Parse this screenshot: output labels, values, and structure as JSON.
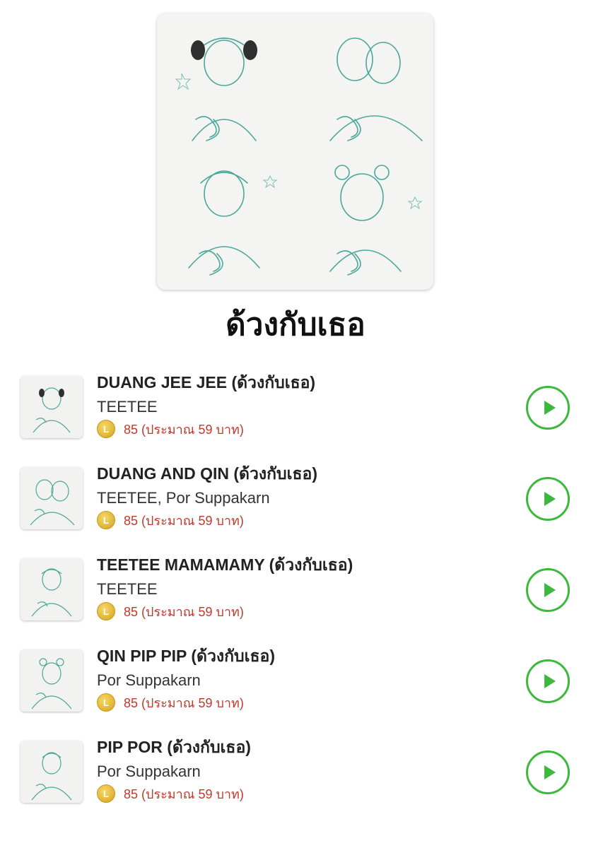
{
  "album": {
    "title": "ด้วงกับเธอ"
  },
  "tracks": [
    {
      "title": "DUANG JEE JEE (ด้วงกับเธอ)",
      "artist": "TEETEE",
      "coin_label": "L",
      "price": "85 (ประมาณ 59 บาท)"
    },
    {
      "title": "DUANG AND QIN (ด้วงกับเธอ)",
      "artist": "TEETEE, Por Suppakarn",
      "coin_label": "L",
      "price": "85 (ประมาณ 59 บาท)"
    },
    {
      "title": "TEETEE MAMAMAMY (ด้วงกับเธอ)",
      "artist": "TEETEE",
      "coin_label": "L",
      "price": "85 (ประมาณ 59 บาท)"
    },
    {
      "title": "QIN PIP PIP (ด้วงกับเธอ)",
      "artist": "Por Suppakarn",
      "coin_label": "L",
      "price": "85 (ประมาณ 59 บาท)"
    },
    {
      "title": "PIP POR (ด้วงกับเธอ)",
      "artist": "Por Suppakarn",
      "coin_label": "L",
      "price": "85 (ประมาณ 59 บาท)"
    }
  ],
  "icons": {
    "play": "play-icon",
    "coin": "line-coin-icon"
  },
  "colors": {
    "accent_green": "#3cb93c",
    "price_red": "#c0392b",
    "sketch_teal": "#4aa89a"
  }
}
